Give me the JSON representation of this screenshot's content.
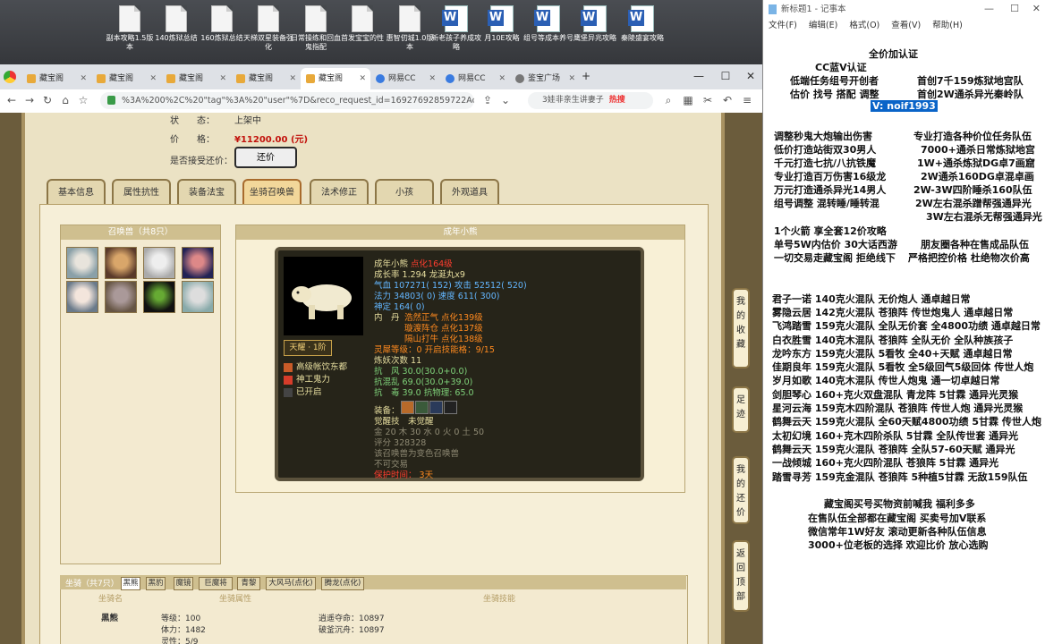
{
  "desktop": {
    "icons": [
      {
        "label": "副本攻略1.5版本",
        "type": "doc"
      },
      {
        "label": "140炼狱总结",
        "type": "doc"
      },
      {
        "label": "160炼狱总结",
        "type": "doc"
      },
      {
        "label": "天梯双星装备强化",
        "type": "doc"
      },
      {
        "label": "日常操练和回血鬼指配",
        "type": "doc"
      },
      {
        "label": "首发宝宝的性",
        "type": "doc"
      },
      {
        "label": "惠智仞城1.0版本",
        "type": "doc"
      },
      {
        "label": "新老孩子养成攻略",
        "type": "word"
      },
      {
        "label": "月10E攻略",
        "type": "word"
      },
      {
        "label": "组号等成本养号",
        "type": "word"
      },
      {
        "label": "鹰堡异兆攻略",
        "type": "word"
      },
      {
        "label": "秦陵盛宴攻略",
        "type": "word"
      }
    ]
  },
  "browser": {
    "tabs": [
      "藏宝阁",
      "藏宝阁",
      "藏宝阁",
      "藏宝阁",
      "藏宝阁",
      "网易CC",
      "网易CC",
      "鉴宝广场"
    ],
    "url": "%3A%200%2C%20\"tag\"%3A%20\"user\"%7D&reco_request_id=16927692859722AoHM",
    "search": "3娃非亲生讲妻子",
    "hot": "热搜"
  },
  "listing": {
    "status_label": "状　　态：",
    "status_value": "上架中",
    "price_label": "价　　格：",
    "price_value": "¥11200.00 (元)",
    "bargain_label": "是否接受还价：",
    "bargain_button": "还价"
  },
  "page_tabs": [
    "基本信息",
    "属性抗性",
    "装备法宝",
    "坐骑召唤兽",
    "法术修正",
    "小孩",
    "外观道具"
  ],
  "pets": {
    "header": "召唤兽（共8只）"
  },
  "detail": {
    "header": "成年小熊",
    "name": "成年小熊",
    "name_tag": "点化164级",
    "growth": "成长率 1.294 龙涎丸x9",
    "hp": "气血 107271( 152) 攻击 52512( 520)",
    "mp": "法力 34803( 0) 速度 611( 300)",
    "spirit": "神定 164( 0)",
    "neidan_label": "内　丹",
    "neidan": [
      "浩然正气 点化139级",
      "璇渡阵仓 点化137级",
      "隔山打牛 点化138级"
    ],
    "lingya": "灵犀等级：0 开启技能格：9/15",
    "yaojue": "炼妖次数 11",
    "res1": "抗　风 30.0(30.0+0.0)",
    "res2": "抗混乱 69.0(30.0+39.0)",
    "res3": "抗　毒 39.0 抗物理: 65.0",
    "equip_label": "装备：",
    "awaken": "觉醒技　未觉醒",
    "elements": "金 20 木 30 水 0 火 0 土 50",
    "rating": "评分 328328",
    "variant": "该召唤兽为变色召唤兽",
    "trade": "不可交易",
    "protect_label": "保护时间：",
    "protect_value": "3天",
    "rank": "天耀 · 1阶",
    "skills": [
      "高级帐饮东都",
      "神工鬼力",
      "已开启"
    ]
  },
  "side_buttons": [
    "我的收藏",
    "足迹",
    "我的还价",
    "返回顶部"
  ],
  "mount": {
    "tabs": [
      "坐骑（共7只）",
      "黑熊",
      "黑豹",
      "魔镜",
      "巨魔将",
      "青黎",
      "大风马(点化)",
      "腾龙(点化)"
    ],
    "cols": [
      "坐骑名",
      "坐骑属性",
      "坐骑技能"
    ],
    "name": "黑熊",
    "attr": [
      "等级：100",
      "体力：1482",
      "灵性：5/9"
    ],
    "skills": [
      "逍遥夺命：10897",
      "破釜沉舟：10897"
    ]
  },
  "notepad": {
    "title": "新标题1 - 记事本",
    "menu": [
      "文件(F)",
      "编辑(E)",
      "格式(O)",
      "查看(V)",
      "帮助(H)"
    ],
    "lines": [
      "全价加认证",
      "CC蓝V认证",
      "低端任务组号开创者",
      "首创7千159炼狱地宫队",
      "估价 找号 搭配 调整",
      "首创2W通杀异光秦岭队",
      "V: noif1993",
      "调整秒鬼大炮输出伤害",
      "专业打造各种价位任务队伍",
      "低价打造站街双30男人",
      "7000+通杀日常炼狱地宫",
      "千元打造七抗/八抗铁魔",
      "1W+通杀炼狱DG卓7画窟",
      "专业打造百万伤害16级龙",
      "2W通杀160DG卓混卓画",
      "万元打造通杀异光14男人",
      "2W-3W四阶睡杀160队伍",
      "组号调整 混转睡/睡转混",
      "2W左右混杀蹭帮强通异光",
      "3W左右混杀无帮强通异光",
      "1个火箭 享全套12价攻略",
      "单号5W内估价 30大话西游",
      "朋友圈各种在售成品队伍",
      "一切交易走藏宝阁 拒绝线下",
      "严格把控价格 杜绝物次价高",
      "君子一诺 140克火混队 无价炮人 通卓越日常",
      "雾隐云居 142克火混队 苍狼阵 传世炮鬼人 通卓越日常",
      "飞鸿踏雪 159克火混队 全队无价套 全4800功绩 通卓越日常",
      "白衣胜雪 140克木混队 苍狼阵 全队无价 全队种族孩子",
      "龙吟东方 159克火混队 5看牧 全40+天赋 通卓越日常",
      "佳期良年 159克火混队 5看牧 全5级回气5级回体 传世人炮",
      "岁月如歌 140克木混队 传世人炮鬼 通一切卓越日常",
      "剑胆琴心 160+克火双盘混队 青龙阵 5甘霖 通异光灵猴",
      "星河云海 159克木四阶混队 苍狼阵 传世人炮 通异光灵猴",
      "鹤舞云天 159克火混队 全60天赋4800功绩 5甘霖 传世人炮",
      "太初幻境 160+克木四阶杀队 5甘霖 全队传世套 通异光",
      "鹤舞云天 159克火混队 苍狼阵 全队57-60天赋 通异光",
      "一战倾城 160+克火四阶混队 苍狼阵 5甘霖 通异光",
      "踏雪寻芳 159克金混队 苍狼阵 5种植5甘霖 无敌159队伍",
      "藏宝阁买号买物资前喊我 福利多多",
      "在售队伍全部都在藏宝阁 买卖号加V联系",
      "微信常年1W好友 滚动更新各种队伍信息",
      "3000+位老板的选择 欢迎比价 放心选购"
    ]
  },
  "colors": {
    "accent": "#c2120c",
    "gold": "#a89262"
  }
}
